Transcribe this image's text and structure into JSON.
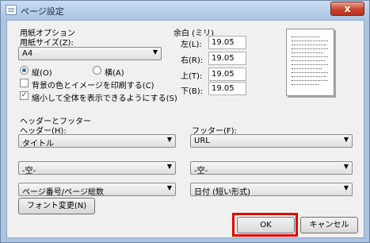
{
  "window": {
    "title": "ページ設定",
    "close_label": "x"
  },
  "paper": {
    "group_label": "用紙オプション",
    "size_label": "用紙サイズ(Z):",
    "size_value": "A4",
    "portrait_label": "縦(O)",
    "landscape_label": "横(A)",
    "orientation_selected": "portrait",
    "print_background_label": "背景の色とイメージを印刷する(C)",
    "print_background_checked": false,
    "shrink_to_fit_label": "縮小して全体を表示できるようにする(S)",
    "shrink_to_fit_checked": true
  },
  "margins": {
    "group_label": "余白 (ミリ)",
    "left_label": "左(L):",
    "left_value": "19.05",
    "right_label": "右(R):",
    "right_value": "19.05",
    "top_label": "上(T):",
    "top_value": "19.05",
    "bottom_label": "下(B):",
    "bottom_value": "19.05"
  },
  "header_footer": {
    "group_label": "ヘッダーとフッター",
    "header_label": "ヘッダー(H):",
    "footer_label": "フッター(F):",
    "header_values": [
      "タイトル",
      "-空-",
      "ページ番号/ページ総数"
    ],
    "footer_values": [
      "URL",
      "-空-",
      "日付 (短い形式)"
    ],
    "font_button": "フォント変更(N)"
  },
  "buttons": {
    "ok": "OK",
    "cancel": "キャンセル"
  },
  "colors": {
    "highlight": "#e00000",
    "title_bar": "#aac4e4"
  }
}
